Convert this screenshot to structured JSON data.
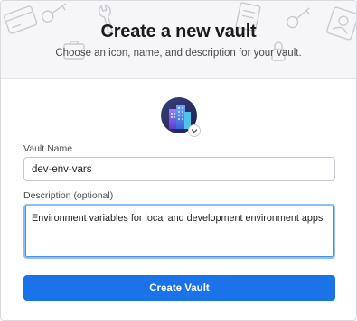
{
  "header": {
    "title": "Create a new vault",
    "subtitle": "Choose an icon, name, and description for your vault."
  },
  "vault_icon": {
    "icon": "city-buildings-icon",
    "picker_icon": "chevron-down-icon"
  },
  "form": {
    "name_label": "Vault Name",
    "name_value": "dev-env-vars",
    "description_label": "Description (optional)",
    "description_value": "Environment variables for local and development environment apps"
  },
  "actions": {
    "create_label": "Create Vault"
  },
  "colors": {
    "primary": "#1a73e8",
    "focus_ring": "#8fc0f5",
    "header_bg": "#f6f6f8"
  }
}
